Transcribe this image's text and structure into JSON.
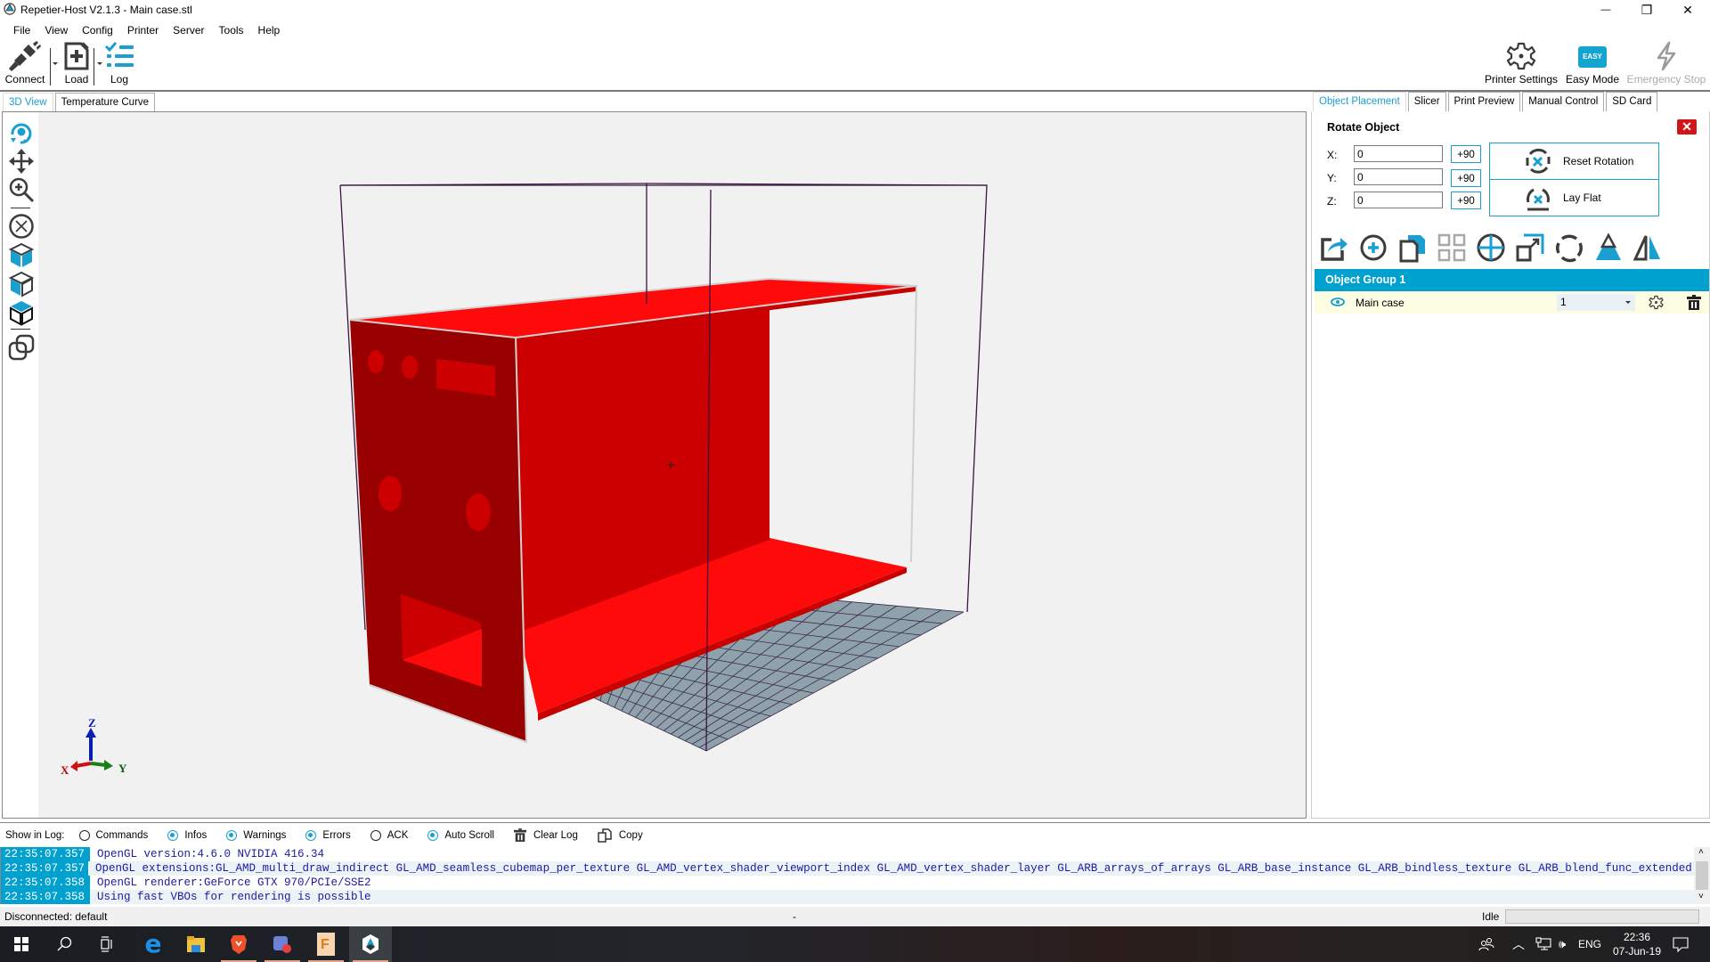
{
  "window": {
    "title": "Repetier-Host V2.1.3 - Main case.stl",
    "controls": {
      "minimize": "—",
      "maximize": "❐",
      "close": "✕"
    }
  },
  "menu": [
    "File",
    "View",
    "Config",
    "Printer",
    "Server",
    "Tools",
    "Help"
  ],
  "toolbar": {
    "connect": "Connect",
    "load": "Load",
    "log": "Log",
    "printer_settings": "Printer Settings",
    "easy_mode": "Easy Mode",
    "easy_badge": "EASY",
    "emergency_stop": "Emergency Stop"
  },
  "left_tabs": [
    {
      "label": "3D View",
      "active": true
    },
    {
      "label": "Temperature Curve",
      "active": false
    }
  ],
  "view_tools": [
    "rotate-view",
    "move-view",
    "zoom-view",
    "fit-view",
    "front-view",
    "side-view",
    "top-view",
    "object-toggle"
  ],
  "scene": {
    "axis_labels": {
      "x": "X",
      "y": "Y",
      "z": "Z"
    },
    "model_color": "#ff0a0a",
    "model_shadow_color": "#990000",
    "bed_color": "#8fa2ab",
    "frame_color": "#3a1540"
  },
  "right_tabs": [
    {
      "label": "Object Placement",
      "active": true
    },
    {
      "label": "Slicer",
      "active": false
    },
    {
      "label": "Print Preview",
      "active": false
    },
    {
      "label": "Manual Control",
      "active": false
    },
    {
      "label": "SD Card",
      "active": false
    }
  ],
  "rotate": {
    "title": "Rotate Object",
    "axes": [
      {
        "label": "X:",
        "value": "0",
        "button": "+90"
      },
      {
        "label": "Y:",
        "value": "0",
        "button": "+90"
      },
      {
        "label": "Z:",
        "value": "0",
        "button": "+90"
      }
    ],
    "reset_rotation": "Reset Rotation",
    "lay_flat": "Lay Flat"
  },
  "object_tools": [
    "export",
    "add-object",
    "copy-objects",
    "autoposition",
    "center-object",
    "scale-object",
    "rotate-object",
    "cut-object",
    "mirror-object"
  ],
  "object_group": {
    "title": "Object Group 1",
    "objects": [
      {
        "name": "Main case",
        "copies": "1"
      }
    ]
  },
  "log": {
    "show_label": "Show in Log:",
    "options": [
      {
        "label": "Commands",
        "checked": false
      },
      {
        "label": "Infos",
        "checked": true
      },
      {
        "label": "Warnings",
        "checked": true
      },
      {
        "label": "Errors",
        "checked": true
      },
      {
        "label": "ACK",
        "checked": false
      },
      {
        "label": "Auto Scroll",
        "checked": true
      }
    ],
    "clear_log": "Clear Log",
    "copy": "Copy",
    "lines": [
      {
        "time": "22:35:07.357",
        "text": "OpenGL version:4.6.0 NVIDIA 416.34"
      },
      {
        "time": "22:35:07.357",
        "text": "OpenGL extensions:GL_AMD_multi_draw_indirect GL_AMD_seamless_cubemap_per_texture GL_AMD_vertex_shader_viewport_index GL_AMD_vertex_shader_layer GL_ARB_arrays_of_arrays GL_ARB_base_instance GL_ARB_bindless_texture GL_ARB_blend_func_extended GI"
      },
      {
        "time": "22:35:07.358",
        "text": "OpenGL renderer:GeForce GTX 970/PCIe/SSE2"
      },
      {
        "time": "22:35:07.358",
        "text": "Using fast VBOs for rendering is possible"
      }
    ]
  },
  "status": {
    "connection": "Disconnected: default",
    "middle": "-",
    "state": "Idle"
  },
  "taskbar": {
    "apps": [
      "windows-start",
      "search",
      "task-view",
      "edge",
      "file-explorer",
      "brave",
      "discord",
      "fusion-360",
      "repetier-host"
    ],
    "tray": {
      "lang": "ENG",
      "time": "22:36",
      "date": "07-Jun-19"
    }
  }
}
